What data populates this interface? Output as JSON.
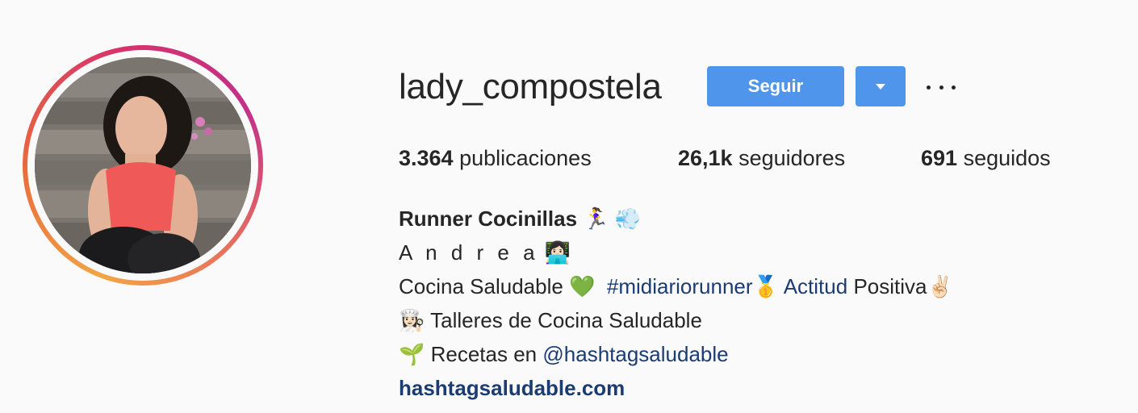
{
  "profile": {
    "username": "lady_compostela",
    "follow_label": "Seguir",
    "dropdown_icon": "caret-down-icon",
    "more_icon": "ellipsis-icon"
  },
  "stats": {
    "posts_count": "3.364",
    "posts_label": "publicaciones",
    "followers_count": "26,1k",
    "followers_label": "seguidores",
    "following_count": "691",
    "following_label": "seguidos"
  },
  "bio": {
    "name": "Runner Cocinillas",
    "name_emoji": "🏃‍♀️ 💨",
    "line1_text": "A n d r e a",
    "line1_emoji": "👩🏻‍💻",
    "line2_text": "Cocina Saludable",
    "line2_emoji": "💚",
    "line2_hashtag": "#midiariorunner",
    "line2_medal": "🥇",
    "line2_link": "Actitud",
    "line2_rest": "Positiva",
    "line2_hand": "✌🏻",
    "line3_emoji": "👩🏻‍🍳",
    "line3_text": "Talleres de Cocina Saludable",
    "line4_emoji": "🌱",
    "line4_text": "Recetas en",
    "line4_mention": "@hashtagsaludable",
    "website": "hashtagsaludable.com"
  },
  "colors": {
    "accent": "#4e95eb",
    "link": "#1b3c72",
    "text": "#262626",
    "background": "#fafafa"
  }
}
